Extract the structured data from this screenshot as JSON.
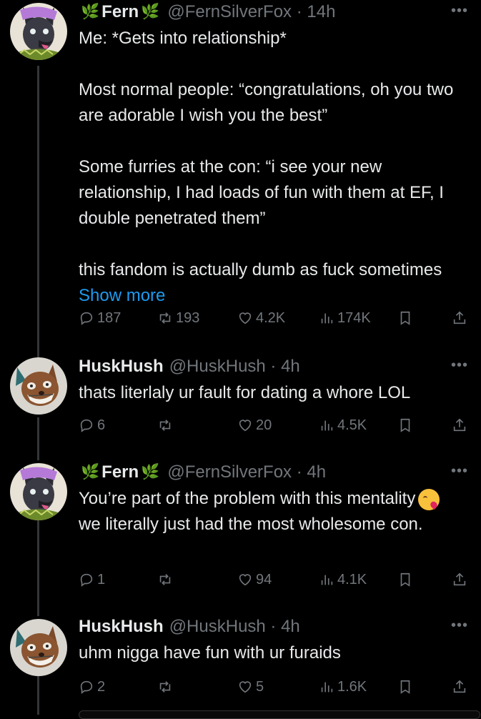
{
  "tweets": [
    {
      "name": "Fern",
      "leaf_left": "🌿",
      "leaf_right": "🌿",
      "handle_time": "@FernSilverFox · 14h",
      "paragraphs": [
        "Me: *Gets into relationship*",
        "Most normal people: “congratulations, oh you two are adorable I wish you the best”",
        "Some furries at the con: “i see your new relationship, I had loads of fun with them at EF, I double penetrated them”",
        "this fandom is actually dumb as fuck sometimes"
      ],
      "show_more": "Show more",
      "replies": "187",
      "reposts": "193",
      "likes": "4.2K",
      "views": "174K"
    },
    {
      "name": "HuskHush",
      "handle_time": "@HuskHush · 4h",
      "text": "thats literlaly ur fault for dating a whore LOL",
      "replies": "6",
      "reposts": "",
      "likes": "20",
      "views": "4.5K"
    },
    {
      "name": "Fern",
      "leaf_left": "🌿",
      "leaf_right": "🌿",
      "handle_time": "@FernSilverFox · 4h",
      "text_a": "You’re part of the problem with this mentality",
      "emoji": "face-blowing-kiss-emoji",
      "text_b": "we literally just had the most wholesome con.",
      "replies": "1",
      "reposts": "",
      "likes": "94",
      "views": "4.1K"
    },
    {
      "name": "HuskHush",
      "handle_time": "@HuskHush · 4h",
      "text": "uhm nigga have fun with ur furaids",
      "replies": "2",
      "reposts": "",
      "likes": "5",
      "views": "1.6K"
    }
  ],
  "more_glyph": "•••",
  "colors": {
    "background": "#000000",
    "text": "#e7e9ea",
    "muted": "#71767b",
    "link": "#1d9bf0"
  }
}
